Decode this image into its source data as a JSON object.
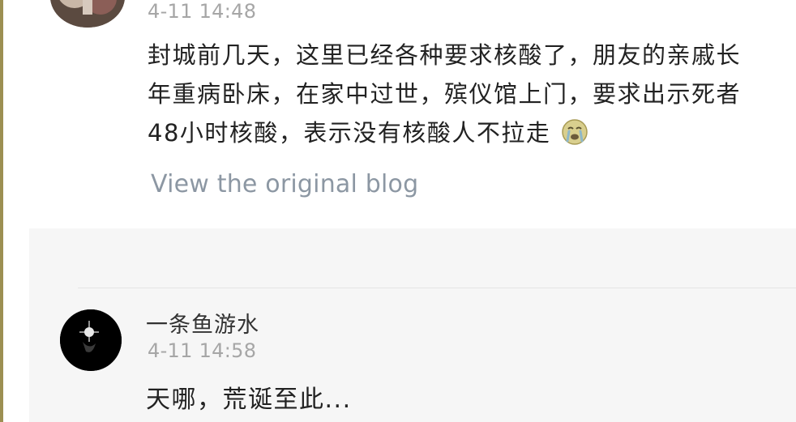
{
  "post": {
    "timestamp": "4-11 14:48",
    "lines": [
      "封城前几天，这里已经各种要求核酸了，朋友的亲戚长",
      "年重病卧床，在家中过世，殡仪馆上门，要求出示死者",
      "48小时核酸，表示没有核酸人不拉走"
    ],
    "emoji_icon": "crying-face-icon",
    "view_original_label": "View the original blog"
  },
  "reply": {
    "username": "一条鱼游水",
    "timestamp": "4-11 14:58",
    "text": "天哪，荒诞至此..."
  },
  "colors": {
    "accent_rule": "#9c8f52",
    "link": "#8c97a3",
    "timestamp": "#a6a6a6",
    "reply_background": "#f6f6f6"
  }
}
